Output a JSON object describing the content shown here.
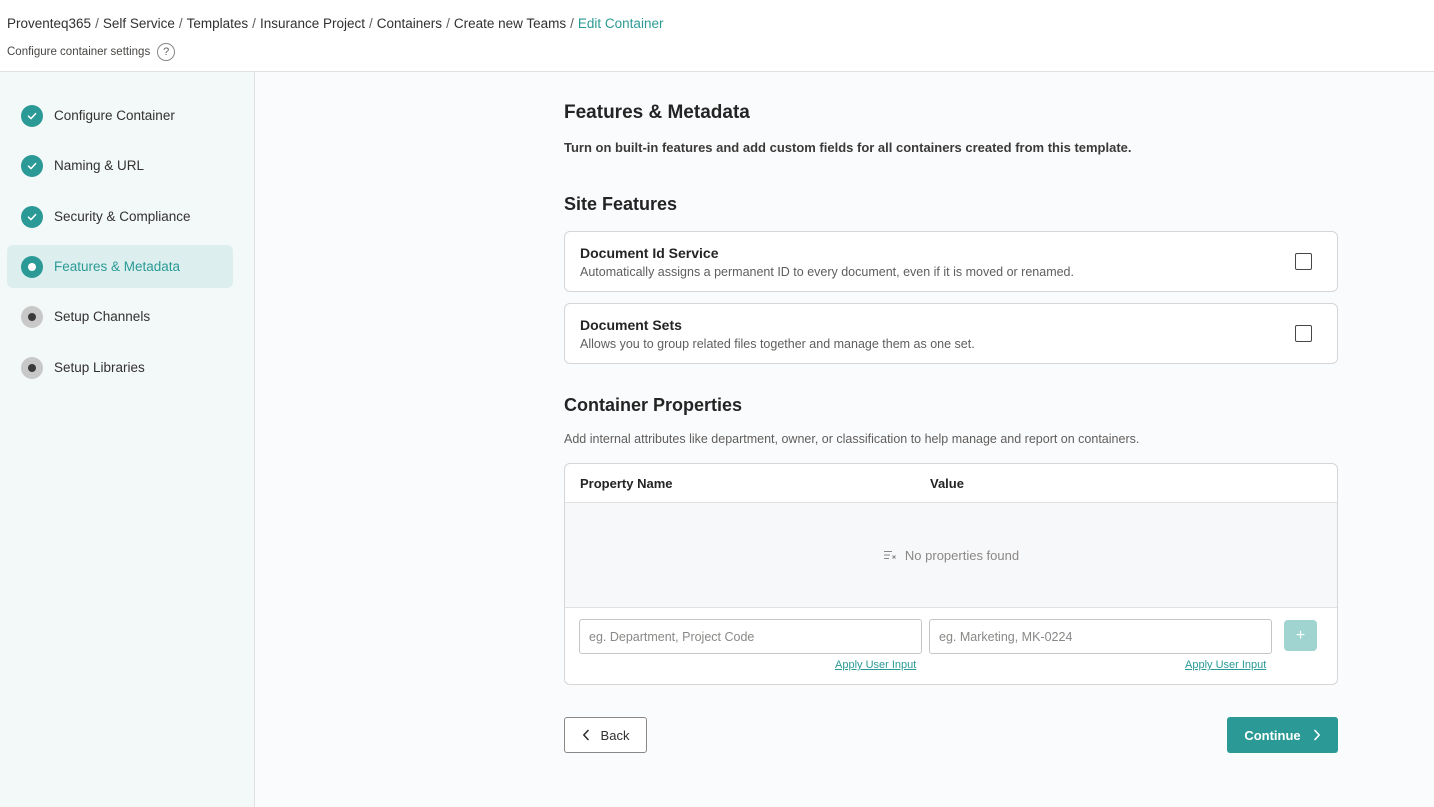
{
  "breadcrumb": {
    "items": [
      "Proventeq365",
      "Self Service",
      "Templates",
      "Insurance Project",
      "Containers",
      "Create new Teams"
    ],
    "current": "Edit Container",
    "separator": "/"
  },
  "header": {
    "subtitle": "Configure container settings",
    "help_symbol": "?"
  },
  "sidebar": {
    "steps": [
      {
        "label": "Configure Container",
        "status": "done"
      },
      {
        "label": "Naming & URL",
        "status": "done"
      },
      {
        "label": "Security & Compliance",
        "status": "done"
      },
      {
        "label": "Features & Metadata",
        "status": "current"
      },
      {
        "label": "Setup Channels",
        "status": "pending"
      },
      {
        "label": "Setup Libraries",
        "status": "pending"
      }
    ]
  },
  "main": {
    "title": "Features & Metadata",
    "intro": "Turn on built-in features and add custom fields for all containers created from this template.",
    "site_features": {
      "heading": "Site Features",
      "items": [
        {
          "title": "Document Id Service",
          "description": "Automatically assigns a permanent ID to every document, even if it is moved or renamed.",
          "checked": false
        },
        {
          "title": "Document Sets",
          "description": "Allows you to group related files together and manage them as one set.",
          "checked": false
        }
      ]
    },
    "container_properties": {
      "heading": "Container Properties",
      "description": "Add internal attributes like department, owner, or classification to help manage and report on containers.",
      "columns": [
        "Property Name",
        "Value"
      ],
      "empty_text": "No properties found",
      "name_placeholder": "eg. Department, Project Code",
      "value_placeholder": "eg. Marketing, MK-0224",
      "apply_label": "Apply User Input",
      "add_symbol": "+"
    },
    "actions": {
      "back_label": "Back",
      "continue_label": "Continue"
    }
  },
  "colors": {
    "accent": "#2b9a96",
    "accent_light": "#dcefee",
    "add_disabled": "#9fd4d1",
    "sidebar_bg": "#f3f8f8"
  }
}
